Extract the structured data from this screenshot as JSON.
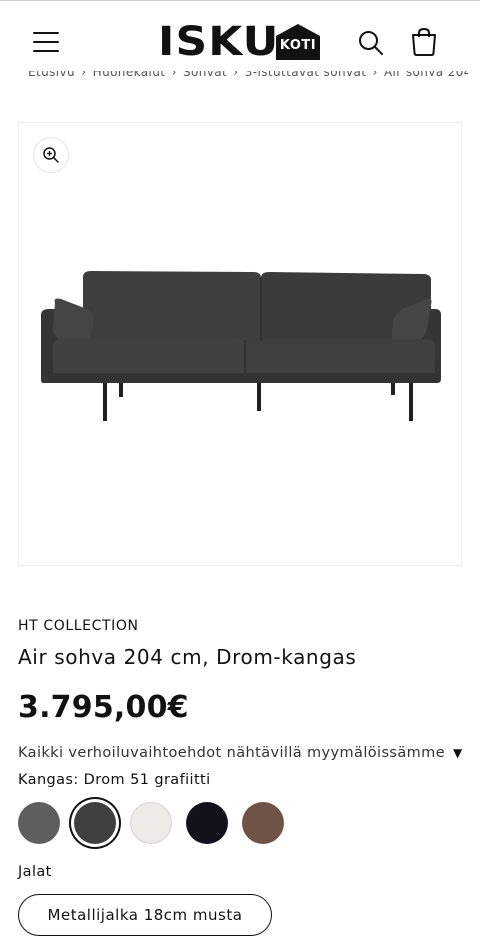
{
  "header": {
    "logo_text": "ISKU",
    "logo_sub": "KOTI",
    "menu_icon": "hamburger-icon",
    "search_icon": "search-icon",
    "cart_icon": "cart-icon"
  },
  "breadcrumb": {
    "items": [
      "Etusivu",
      "Huonekalut",
      "Sohvat",
      "3-istuttavat sohvat",
      "Air sohva 204"
    ],
    "separator": "›"
  },
  "gallery": {
    "zoom_icon": "zoom-in-icon",
    "image_subject": "dark grey three-seat sofa with metal legs"
  },
  "product": {
    "vendor": "HT COLLECTION",
    "title": "Air sohva 204 cm, Drom-kangas",
    "price": "3.795,00€",
    "upholstery_note": "Kaikki verhoiluvaihtoehdot nähtävillä myymälöissämme",
    "upholstery_caret": "▼",
    "fabric_label": "Kangas: Drom 51 grafiitti",
    "swatches": [
      {
        "name": "harmaa",
        "color": "#5e5e5e",
        "selected": false
      },
      {
        "name": "grafiitti",
        "color": "#3f3f3f",
        "selected": true
      },
      {
        "name": "valkoinen",
        "color": "#ecebe8",
        "selected": false
      },
      {
        "name": "tummansininen",
        "color": "#10131c",
        "selected": false
      },
      {
        "name": "ruskea",
        "color": "#6f5346",
        "selected": false
      }
    ],
    "legs_label": "Jalat",
    "legs_value": "Metallijalka 18cm musta"
  }
}
